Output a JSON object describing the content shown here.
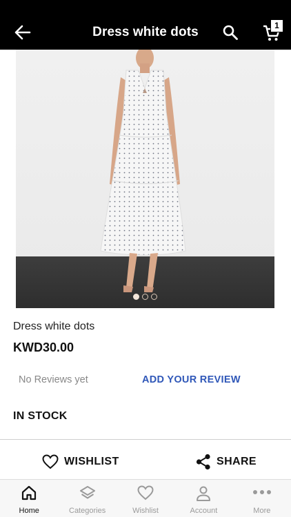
{
  "header": {
    "title": "Dress white dots",
    "cart_count": "1"
  },
  "carousel": {
    "total": 3,
    "active_index": 0
  },
  "product": {
    "name": "Dress white dots",
    "price": "KWD30.00",
    "reviews_text": "No Reviews yet",
    "add_review_label": "ADD YOUR REVIEW",
    "stock_status": "IN STOCK"
  },
  "actions": {
    "wishlist_label": "WISHLIST",
    "share_label": "SHARE"
  },
  "bottom_nav": {
    "items": [
      {
        "label": "Home",
        "icon": "home-icon",
        "active": true
      },
      {
        "label": "Categories",
        "icon": "layers-icon",
        "active": false
      },
      {
        "label": "Wishlist",
        "icon": "heart-icon",
        "active": false
      },
      {
        "label": "Account",
        "icon": "person-icon",
        "active": false
      },
      {
        "label": "More",
        "icon": "more-dots-icon",
        "active": false
      }
    ]
  },
  "colors": {
    "header_bg": "#000000",
    "accent_link": "#2f57b8",
    "nav_active": "#111111",
    "nav_inactive": "#9a9a9a"
  }
}
